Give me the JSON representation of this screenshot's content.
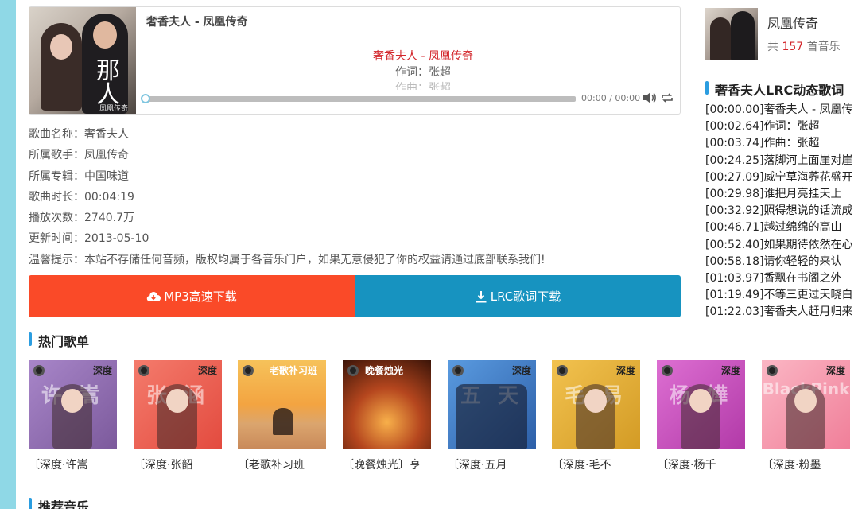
{
  "player": {
    "title": "奢香夫人 - 凤凰传奇",
    "cover_caption": "凤凰传奇",
    "cover_calligraphy": "那人",
    "lyrics": [
      "奢香夫人 - 凤凰传奇",
      "作词：张超",
      "作曲：张超"
    ],
    "time": "00:00 / 00:00",
    "progress": 0
  },
  "info": [
    {
      "label": "歌曲名称：",
      "value": "奢香夫人"
    },
    {
      "label": "所属歌手：",
      "value": "凤凰传奇"
    },
    {
      "label": "所属专辑：",
      "value": "中国味道"
    },
    {
      "label": "歌曲时长：",
      "value": "00:04:19"
    },
    {
      "label": "播放次数：",
      "value": "2740.7万"
    },
    {
      "label": "更新时间：",
      "value": "2013-05-10"
    },
    {
      "label": "温馨提示：",
      "value": "本站不存储任何音频，版权均属于各音乐门户，如果无意侵犯了你的权益请通过底部联系我们!"
    }
  ],
  "download": {
    "mp3_label": "MP3高速下载",
    "lrc_label": "LRC歌词下载",
    "mp3_color": "#fa4a28",
    "lrc_color": "#1793c0"
  },
  "sections": {
    "hot_playlists": "热门歌单",
    "recommended": "推荐音乐"
  },
  "playlists": [
    {
      "name": "〔深度·许嵩",
      "badge": "深度",
      "cover_text": "许 嵩",
      "bg": "linear-gradient(135deg,#a886c9,#7c5a9c)"
    },
    {
      "name": "〔深度·张韶",
      "badge": "深度",
      "cover_text": "张 涵",
      "bg": "linear-gradient(135deg,#f47b6c,#e34b3f)"
    },
    {
      "name": "〔老歌补习班",
      "badge": "老歌补习班",
      "cover_text": "",
      "bg": "linear-gradient(180deg,#f6c25a 0%,#f3a441 50%,#dba56e 72%,#c98a5a 100%)"
    },
    {
      "name": "〔晚餐烛光〕亨",
      "badge": "晚餐烛光",
      "cover_text": "",
      "bg": "radial-gradient(circle at 50% 70%,#f8b04a 0%,#b5461e 45%,#3a1408 100%)"
    },
    {
      "name": "〔深度·五月",
      "badge": "深度",
      "cover_text": "五 天",
      "bg": "linear-gradient(135deg,#5a9be0,#2d5fa8)"
    },
    {
      "name": "〔深度·毛不",
      "badge": "深度",
      "cover_text": "毛 易",
      "bg": "linear-gradient(135deg,#f2c24f,#d39b25)"
    },
    {
      "name": "〔深度·杨千",
      "badge": "深度",
      "cover_text": "杨 嬅",
      "bg": "linear-gradient(135deg,#dd6fd2,#b23aa8)"
    },
    {
      "name": "〔深度·粉墨",
      "badge": "深度",
      "cover_text": "BlackPink",
      "bg": "linear-gradient(135deg,#fbb6c4,#f07f99)"
    }
  ],
  "artist": {
    "name": "凤凰传奇",
    "count_prefix": "共",
    "count": "157",
    "count_suffix": "首音乐"
  },
  "lrc": {
    "title": "奢香夫人LRC动态歌词",
    "lines": [
      "[00:00.00]奢香夫人 - 凤凰传",
      "[00:02.64]作词：张超",
      "[00:03.74]作曲：张超",
      "[00:24.25]落脚河上面崖对崖",
      "[00:27.09]威宁草海荞花盛开",
      "[00:29.98]谁把月亮挂天上",
      "[00:32.92]照得想说的话流成",
      "[00:46.71]越过绵绵的高山",
      "[00:52.40]如果期待依然在心",
      "[00:58.18]请你轻轻的来认",
      "[01:03.97]香飘在书阁之外",
      "[01:19.49]不等三更过天晓白",
      "[01:22.03]奢香夫人赶月归来"
    ]
  },
  "colors": {
    "accent_blue": "#2b9de0",
    "highlight_red": "#d3262b",
    "left_bar": "#8fd8e6"
  }
}
